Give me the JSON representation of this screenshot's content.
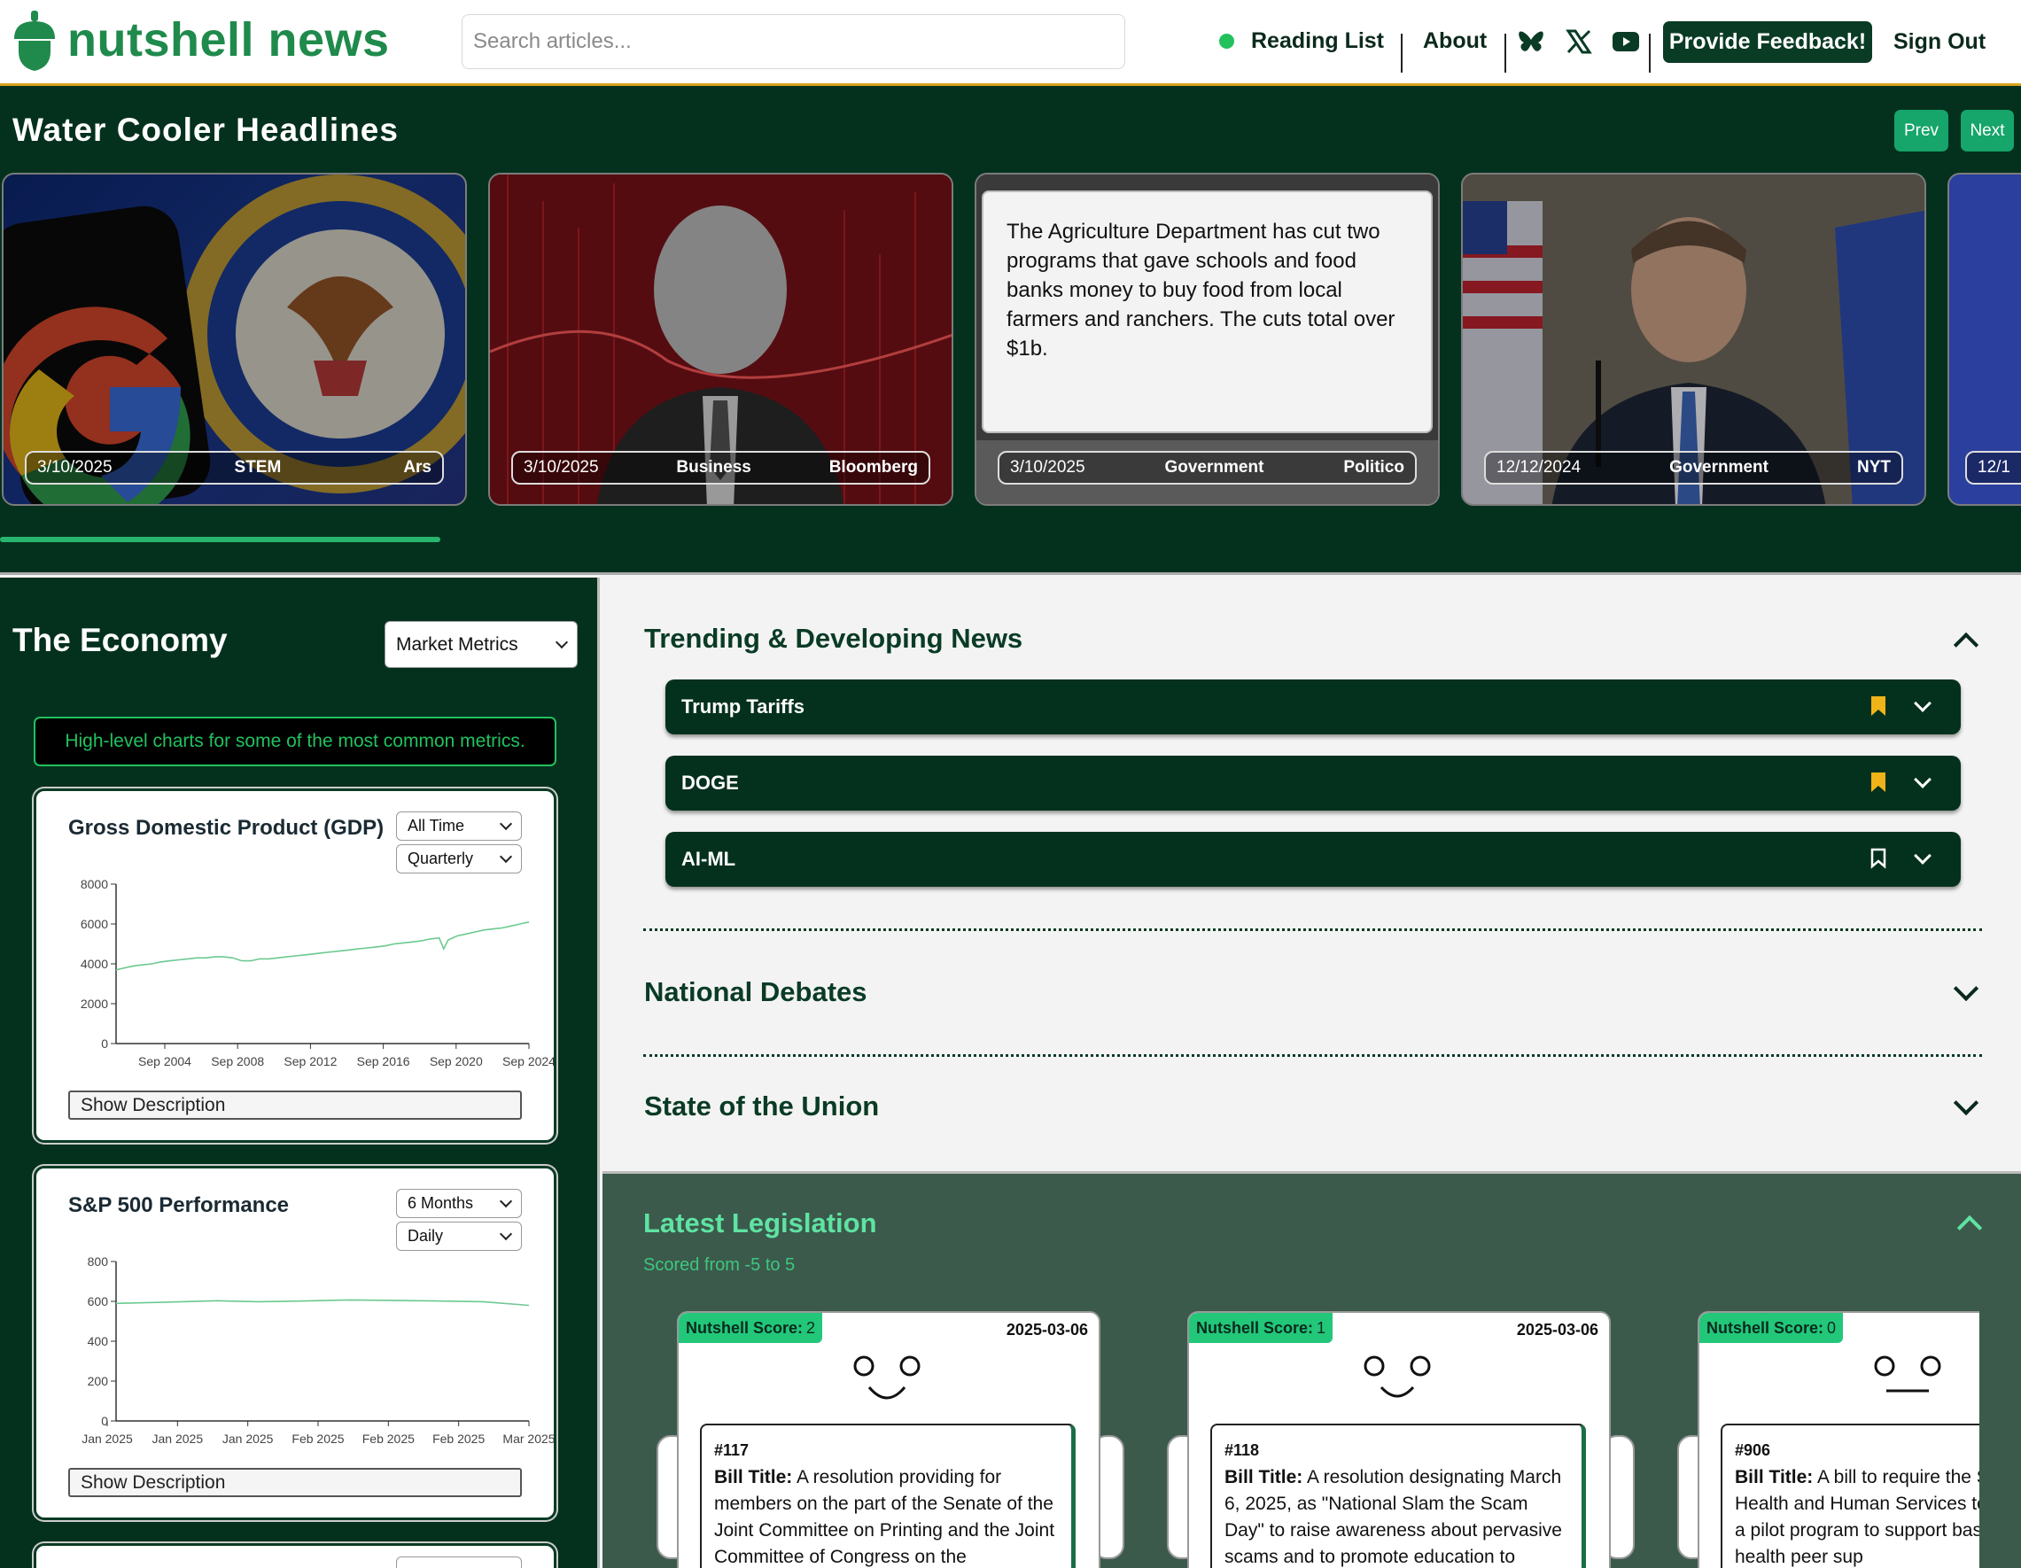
{
  "header": {
    "brand": "nutshell news",
    "search_placeholder": "Search articles...",
    "reading_list": "Reading List",
    "about": "About",
    "feedback": "Provide Feedback!",
    "sign_out": "Sign Out",
    "icons": [
      "acorn-logo-icon",
      "bluesky-icon",
      "x-icon",
      "youtube-icon"
    ],
    "colors": {
      "brand_green": "#1f8a4c",
      "dark_green": "#04311e",
      "accent_gold": "#d9a21b"
    }
  },
  "headlines": {
    "title": "Water Cooler Headlines",
    "prev": "Prev",
    "next": "Next",
    "cards": [
      {
        "date": "3/10/2025",
        "category": "STEM",
        "source": "Ars"
      },
      {
        "date": "3/10/2025",
        "category": "Business",
        "source": "Bloomberg"
      },
      {
        "date": "3/10/2025",
        "category": "Government",
        "source": "Politico",
        "text": "The Agriculture Department has cut two programs that gave schools and food banks money to buy food from local farmers and ranchers. The cuts total over $1b."
      },
      {
        "date": "12/12/2024",
        "category": "Government",
        "source": "NYT"
      },
      {
        "date": "12/1"
      }
    ]
  },
  "economy": {
    "title": "The Economy",
    "view_select": "Market Metrics",
    "note": "High-level charts for some of the most common metrics.",
    "show_description": "Show Description",
    "gdp": {
      "title": "Gross Domestic Product (GDP)",
      "range": "All Time",
      "interval": "Quarterly"
    },
    "sp500": {
      "title": "S&P 500 Performance",
      "range": "6 Months",
      "interval": "Daily"
    }
  },
  "chart_data": [
    {
      "type": "line",
      "title": "Gross Domestic Product (GDP)",
      "xlabel": "",
      "ylabel": "",
      "x_ticks": [
        "Sep 2004",
        "Sep 2008",
        "Sep 2012",
        "Sep 2016",
        "Sep 2020",
        "Sep 2024"
      ],
      "y_ticks": [
        0,
        2000,
        4000,
        6000,
        8000
      ],
      "ylim": [
        0,
        8000
      ],
      "x": [
        2002.0,
        2002.5,
        2003.0,
        2003.5,
        2004.0,
        2004.5,
        2005.0,
        2005.5,
        2006.0,
        2006.5,
        2007.0,
        2007.5,
        2008.0,
        2008.5,
        2009.0,
        2009.5,
        2010.0,
        2010.5,
        2011.0,
        2011.5,
        2012.0,
        2012.5,
        2013.0,
        2013.5,
        2014.0,
        2014.5,
        2015.0,
        2015.5,
        2016.0,
        2016.5,
        2017.0,
        2017.5,
        2018.0,
        2018.5,
        2019.0,
        2019.5,
        2020.0,
        2020.25,
        2020.5,
        2021.0,
        2021.5,
        2022.0,
        2022.5,
        2023.0,
        2023.5,
        2024.0,
        2024.5,
        2025.0
      ],
      "values": [
        3700,
        3800,
        3900,
        3950,
        4000,
        4100,
        4150,
        4200,
        4250,
        4300,
        4300,
        4350,
        4350,
        4300,
        4150,
        4150,
        4250,
        4250,
        4300,
        4350,
        4400,
        4450,
        4500,
        4550,
        4600,
        4650,
        4700,
        4750,
        4800,
        4850,
        4900,
        5000,
        5050,
        5100,
        5150,
        5250,
        5300,
        4750,
        5200,
        5400,
        5500,
        5600,
        5700,
        5750,
        5800,
        5900,
        6000,
        6100
      ],
      "grid": false
    },
    {
      "type": "line",
      "title": "S&P 500 Performance",
      "xlabel": "",
      "ylabel": "",
      "x_ticks": [
        "Jan 2025",
        "Jan 2025",
        "Jan 2025",
        "Feb 2025",
        "Feb 2025",
        "Feb 2025",
        "Mar 2025"
      ],
      "y_ticks": [
        0,
        200,
        400,
        600,
        800
      ],
      "ylim": [
        0,
        800
      ],
      "x": [
        "2024-12-10",
        "2024-12-20",
        "2025-01-01",
        "2025-01-10",
        "2025-01-20",
        "2025-01-30",
        "2025-02-08",
        "2025-02-18",
        "2025-02-28",
        "2025-03-10"
      ],
      "values": [
        590,
        595,
        603,
        598,
        602,
        607,
        605,
        602,
        598,
        580
      ],
      "grid": false
    }
  ],
  "trending": {
    "title": "Trending & Developing News",
    "topics": [
      {
        "label": "Trump Tariffs",
        "bookmarked": true
      },
      {
        "label": "DOGE",
        "bookmarked": true
      },
      {
        "label": "AI-ML",
        "bookmarked": false
      }
    ],
    "national_debates": "National Debates",
    "state_of_union": "State of the Union"
  },
  "legislation": {
    "title": "Latest Legislation",
    "subtitle": "Scored from -5 to 5",
    "score_label": "Nutshell Score:",
    "bill_title_label": "Bill Title:",
    "bills": [
      {
        "score": "2",
        "date": "2025-03-06",
        "number": "#117",
        "title": "A resolution providing for members on the part of the Senate of the Joint Committee on Printing and the Joint Committee of Congress on the",
        "face": "smile"
      },
      {
        "score": "1",
        "date": "2025-03-06",
        "number": "#118",
        "title": "A resolution designating March 6, 2025, as \"National Slam the Scam Day\" to raise awareness about pervasive scams and to promote education to",
        "face": "smile"
      },
      {
        "score": "0",
        "date": "",
        "number": "#906",
        "title": "A bill to require the Secretary of Health and Human Services to carry out a pilot program to support based mental health peer sup",
        "face": "neutral"
      }
    ]
  }
}
